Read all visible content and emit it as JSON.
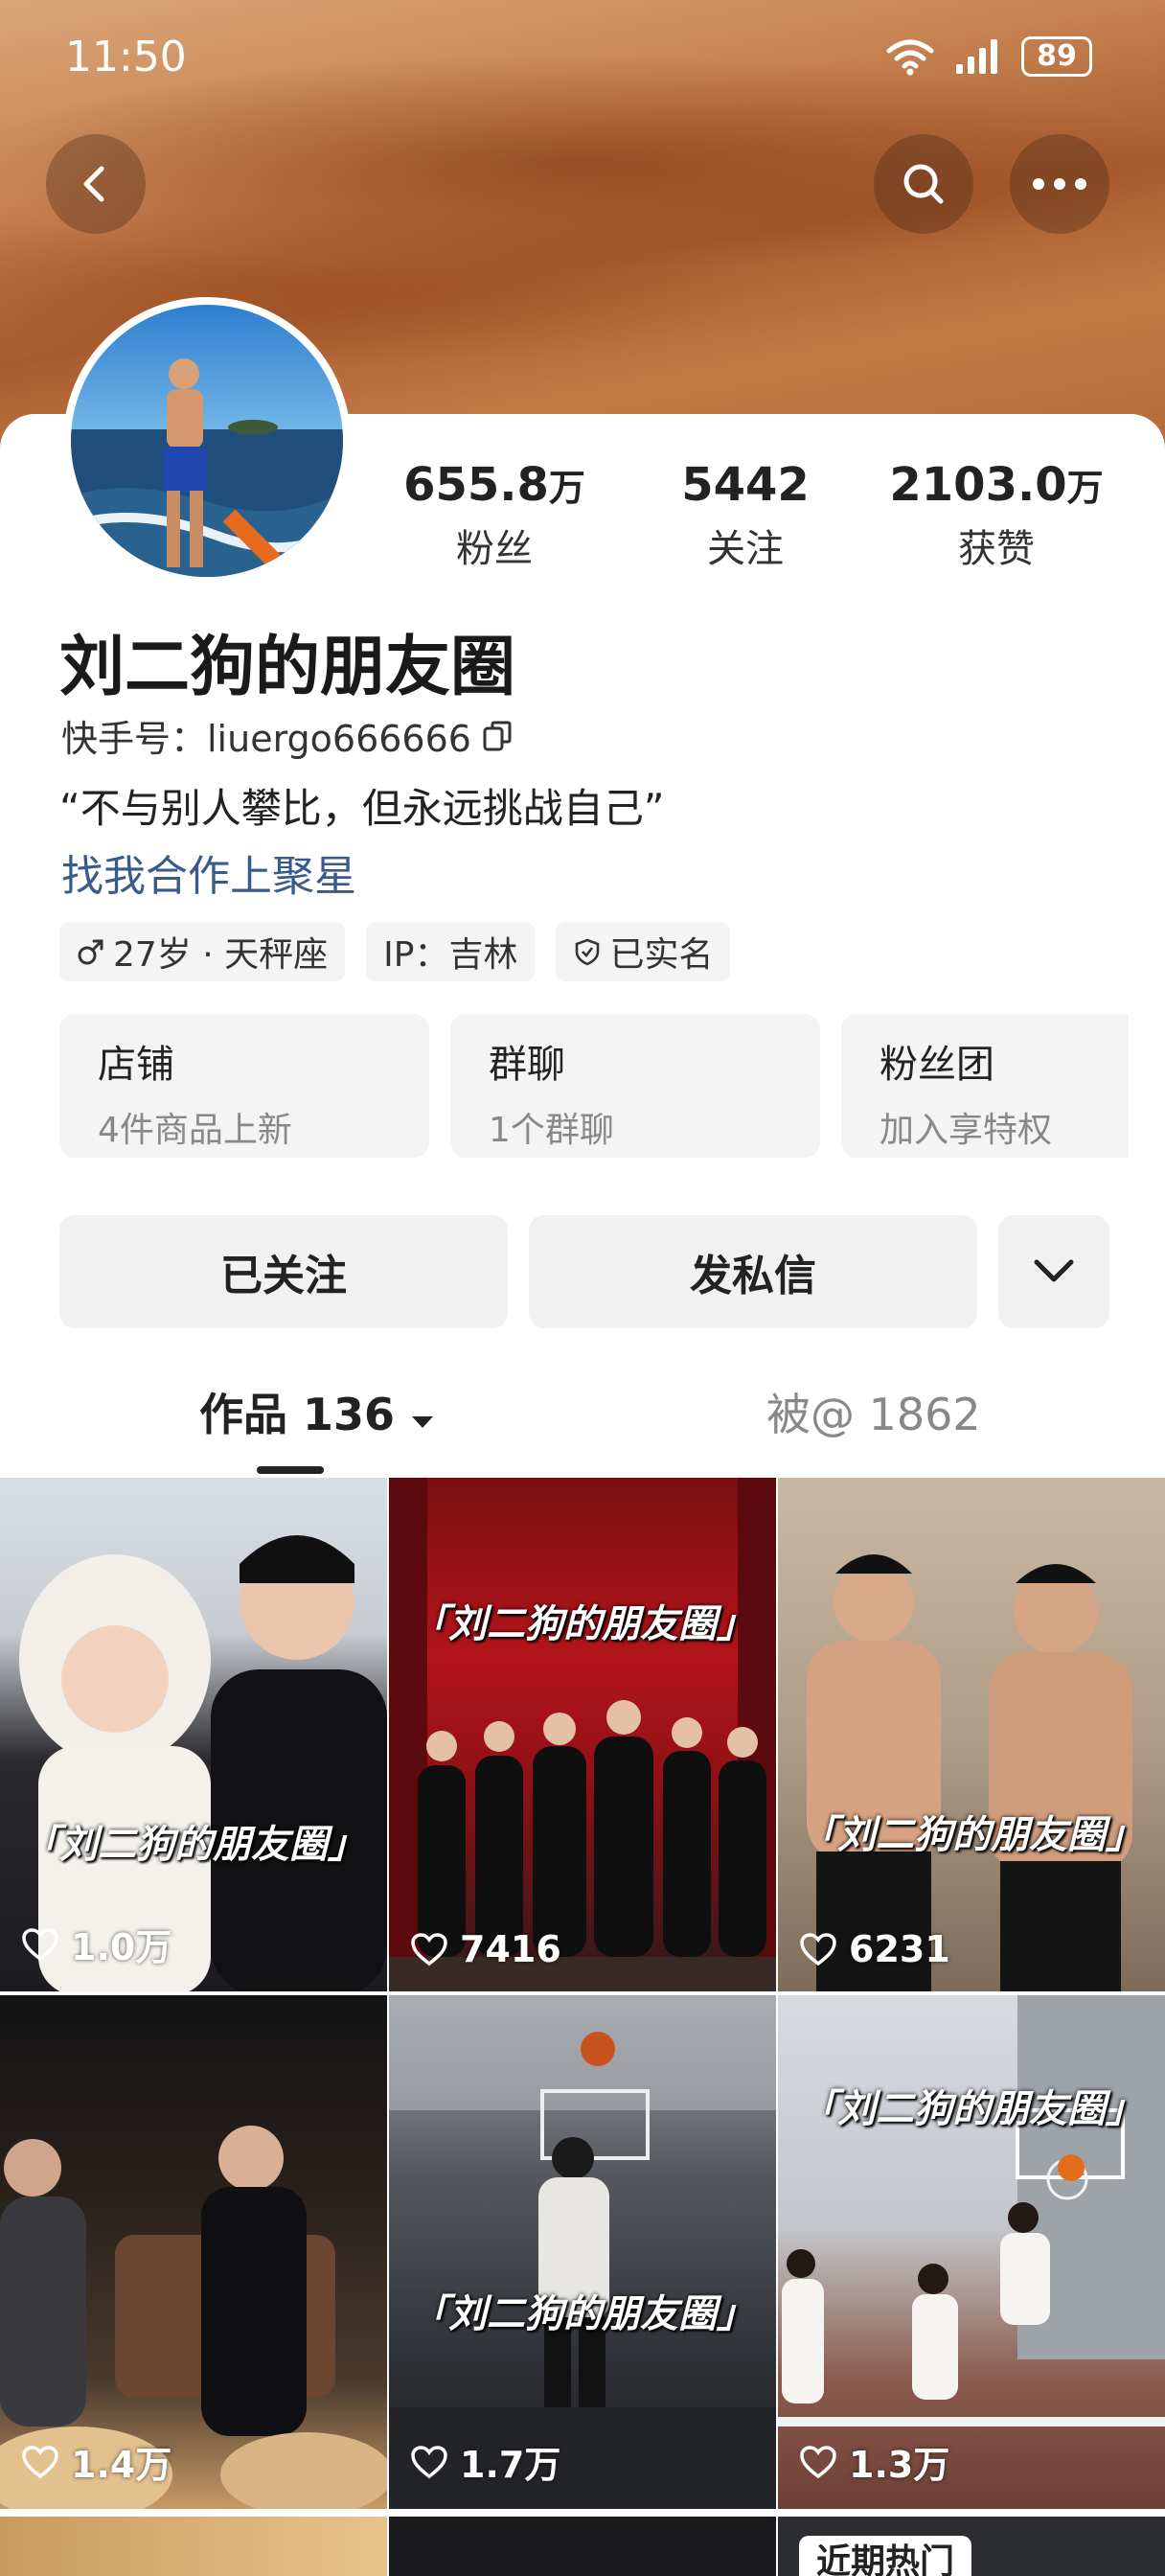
{
  "status": {
    "time": "11:50",
    "battery": "89"
  },
  "profile": {
    "stats": [
      {
        "value": "655.8",
        "unit": "万",
        "label": "粉丝"
      },
      {
        "value": "5442",
        "unit": "",
        "label": "关注"
      },
      {
        "value": "2103.0",
        "unit": "万",
        "label": "获赞"
      }
    ],
    "nickname": "刘二狗的朋友圈",
    "account": "快手号：liuergo666666",
    "bio": "“不与别人攀比，但永远挑战自己”",
    "coop_link": "找我合作上聚星",
    "tags": [
      {
        "icon": "male-icon",
        "text": "27岁 · 天秤座"
      },
      {
        "icon": "",
        "text": "IP：吉林"
      },
      {
        "icon": "verified-shield-icon",
        "text": "已实名"
      }
    ],
    "cards": [
      {
        "title": "店铺",
        "sub": "4件商品上新"
      },
      {
        "title": "群聊",
        "sub": "1个群聊"
      },
      {
        "title": "粉丝团",
        "sub": "加入享特权"
      }
    ],
    "actions": {
      "follow": "已关注",
      "message": "发私信"
    }
  },
  "tabs": {
    "works": "作品 136",
    "mentions": "被@ 1862"
  },
  "videos": [
    {
      "caption": "「刘二狗的朋友圈」",
      "likes": "1.0万"
    },
    {
      "caption": "「刘二狗的朋友圈」",
      "likes": "7416"
    },
    {
      "caption": "「刘二狗的朋友圈」",
      "likes": "6231"
    },
    {
      "caption": "",
      "likes": "1.4万"
    },
    {
      "caption": "「刘二狗的朋友圈」",
      "likes": "1.7万"
    },
    {
      "caption": "「刘二狗的朋友圈」",
      "likes": "1.3万"
    }
  ],
  "hot_badge": "近期热门",
  "colors": {
    "link": "#3a5a8c",
    "card_bg": "#f4f4f5",
    "banner": "#b36a38"
  }
}
